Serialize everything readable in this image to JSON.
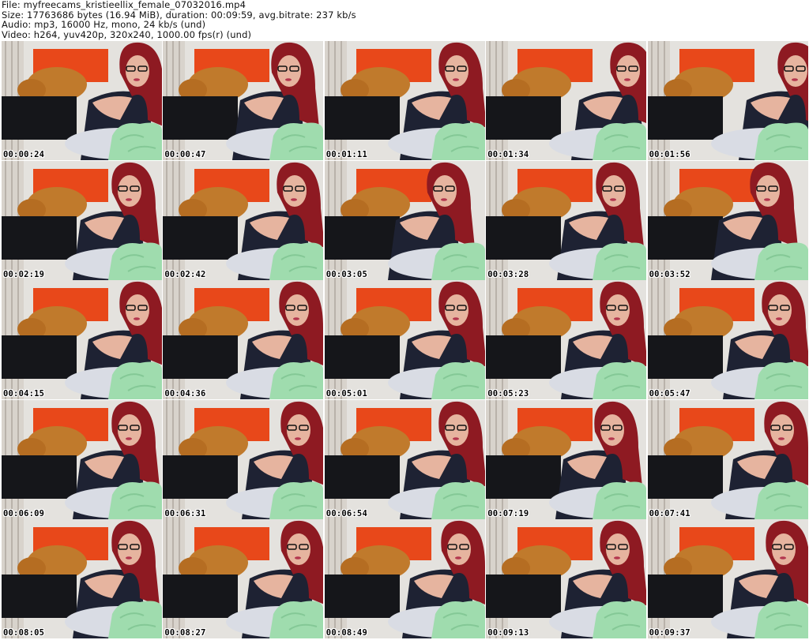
{
  "header": {
    "file": "File: myfreecams_kristieellix_female_07032016.mp4",
    "size": "Size: 17763686 bytes (16.94 MiB), duration: 00:09:59, avg.bitrate: 237 kb/s",
    "audio": "Audio: mp3, 16000 Hz, mono, 24 kb/s (und)",
    "video": "Video: h264, yuv420p, 320x240, 1000.00 fps(r) (und)"
  },
  "colors": {
    "background": "#ffffff",
    "wall": "#e4e2de",
    "headboard": "#e8481a",
    "hair": "#8e1a22",
    "top": "#1e2233",
    "blanket": "#9fdcae",
    "teddy": "#c07a2c",
    "skin": "#e6b49f"
  },
  "thumbnails": [
    {
      "time": "00:00:24"
    },
    {
      "time": "00:00:47"
    },
    {
      "time": "00:01:11"
    },
    {
      "time": "00:01:34"
    },
    {
      "time": "00:01:56"
    },
    {
      "time": "00:02:19"
    },
    {
      "time": "00:02:42"
    },
    {
      "time": "00:03:05"
    },
    {
      "time": "00:03:28"
    },
    {
      "time": "00:03:52"
    },
    {
      "time": "00:04:15"
    },
    {
      "time": "00:04:36"
    },
    {
      "time": "00:05:01"
    },
    {
      "time": "00:05:23"
    },
    {
      "time": "00:05:47"
    },
    {
      "time": "00:06:09"
    },
    {
      "time": "00:06:31"
    },
    {
      "time": "00:06:54"
    },
    {
      "time": "00:07:19"
    },
    {
      "time": "00:07:41"
    },
    {
      "time": "00:08:05"
    },
    {
      "time": "00:08:27"
    },
    {
      "time": "00:08:49"
    },
    {
      "time": "00:09:13"
    },
    {
      "time": "00:09:37"
    }
  ]
}
